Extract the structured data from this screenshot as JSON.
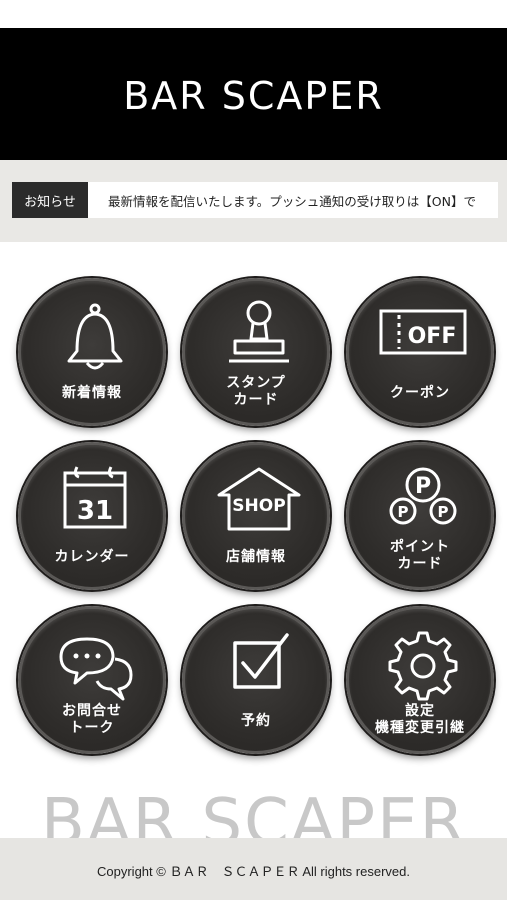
{
  "header": {
    "title": "BAR  SCAPER"
  },
  "notice": {
    "label": "お知らせ",
    "text": "最新情報を配信いたします。プッシュ通知の受け取りは【ON】で"
  },
  "menu": [
    {
      "label": "新着情報",
      "icon": "bell-icon"
    },
    {
      "label": "スタンプ\nカード",
      "icon": "stamp-icon"
    },
    {
      "label": "クーポン",
      "icon": "coupon-icon",
      "icon_text": "OFF"
    },
    {
      "label": "カレンダー",
      "icon": "calendar-icon",
      "icon_text": "31"
    },
    {
      "label": "店舗情報",
      "icon": "shop-icon",
      "icon_text": "SHOP"
    },
    {
      "label": "ポイント\nカード",
      "icon": "point-icon",
      "icon_text": "P"
    },
    {
      "label": "お問合せ\nトーク",
      "icon": "chat-icon"
    },
    {
      "label": "予約",
      "icon": "checkbox-icon"
    },
    {
      "label": "設定\n機種変更引継",
      "icon": "gear-icon"
    }
  ],
  "footer": {
    "brand": "BAR  SCAPER",
    "copyright": "Copyright © ＢＡＲ　ＳＣＡＰＥＲ All rights reserved."
  }
}
